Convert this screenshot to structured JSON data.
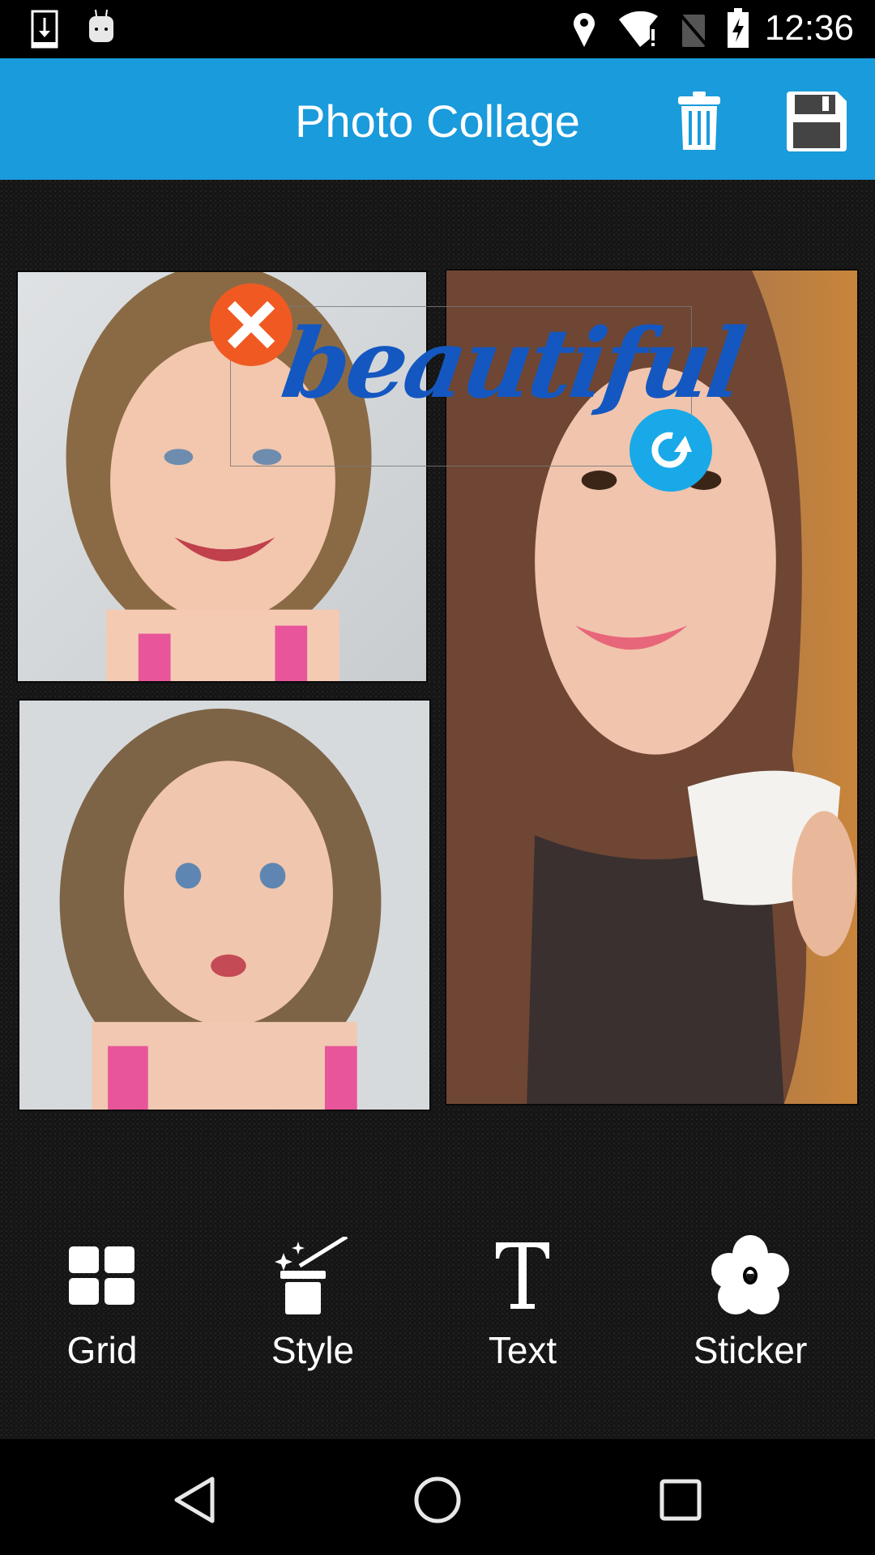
{
  "status_bar": {
    "time": "12:36",
    "icons": [
      "download-icon",
      "android-icon",
      "location-icon",
      "wifi-alert-icon",
      "no-sim-icon",
      "battery-charging-icon"
    ]
  },
  "app_bar": {
    "title": "Photo Collage",
    "actions": [
      {
        "name": "delete",
        "icon": "trash-icon"
      },
      {
        "name": "save",
        "icon": "save-icon"
      }
    ],
    "color": "#1a9bdb"
  },
  "collage": {
    "photos": [
      {
        "description": "Smiling girl"
      },
      {
        "description": "Girl making a face"
      },
      {
        "description": "Woman holding coffee cup"
      }
    ],
    "text_sticker": {
      "text": "beautiful",
      "color": "#1457c0",
      "delete_handle": "close-icon",
      "rotate_handle": "rotate-icon"
    }
  },
  "toolbar": {
    "items": [
      {
        "label": "Grid",
        "icon": "grid-icon"
      },
      {
        "label": "Style",
        "icon": "magic-wand-icon"
      },
      {
        "label": "Text",
        "icon": "text-icon"
      },
      {
        "label": "Sticker",
        "icon": "flower-icon"
      }
    ]
  },
  "nav_bar": {
    "buttons": [
      "back",
      "home",
      "recents"
    ]
  }
}
